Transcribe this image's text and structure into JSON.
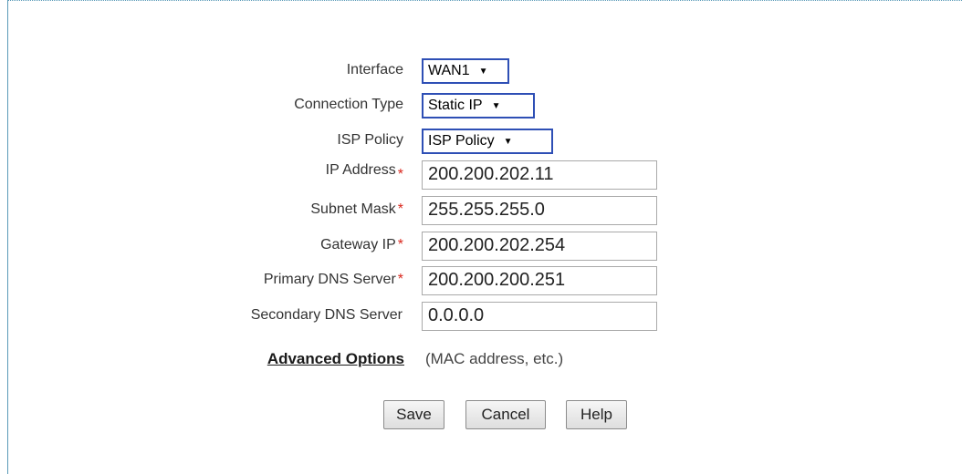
{
  "form": {
    "interface": {
      "label": "Interface",
      "value": "WAN1"
    },
    "connection_type": {
      "label": "Connection Type",
      "value": "Static IP"
    },
    "isp_policy": {
      "label": "ISP Policy",
      "value": "ISP Policy"
    },
    "ip_address": {
      "label": "IP Address",
      "value": "200.200.202.11",
      "required": true
    },
    "subnet_mask": {
      "label": "Subnet Mask",
      "value": "255.255.255.0",
      "required": true
    },
    "gateway_ip": {
      "label": "Gateway IP",
      "value": "200.200.202.254",
      "required": true
    },
    "primary_dns": {
      "label": "Primary DNS Server",
      "value": "200.200.200.251",
      "required": true
    },
    "secondary_dns": {
      "label": "Secondary DNS Server",
      "value": "0.0.0.0"
    }
  },
  "advanced": {
    "link_label": "Advanced Options",
    "note": "(MAC address, etc.)"
  },
  "buttons": {
    "save": "Save",
    "cancel": "Cancel",
    "help": "Help"
  },
  "symbols": {
    "required": "*",
    "dropdown_arrow": "▼"
  },
  "colors": {
    "select_border": "#2e4fb5",
    "required_star": "#d9261c",
    "frame_border": "#5a9ab8"
  }
}
